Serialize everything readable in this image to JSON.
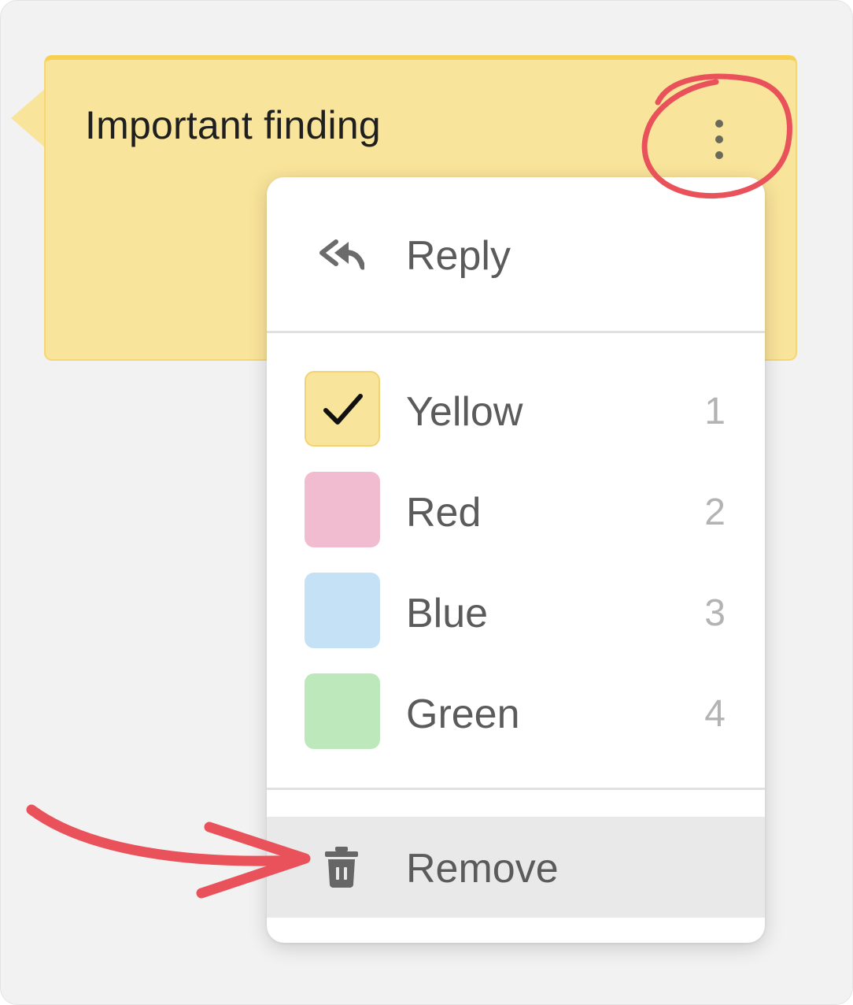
{
  "note": {
    "title": "Important finding",
    "color": "#f9e49b",
    "menu_icon": "more-vertical-icon"
  },
  "menu": {
    "reply": {
      "label": "Reply",
      "icon": "reply-all-icon"
    },
    "colors": [
      {
        "label": "Yellow",
        "shortcut": "1",
        "color": "#f9e49b",
        "selected": true
      },
      {
        "label": "Red",
        "shortcut": "2",
        "color": "#f1bcd0",
        "selected": false
      },
      {
        "label": "Blue",
        "shortcut": "3",
        "color": "#c5e1f6",
        "selected": false
      },
      {
        "label": "Green",
        "shortcut": "4",
        "color": "#bde8bb",
        "selected": false
      }
    ],
    "remove": {
      "label": "Remove",
      "icon": "trash-icon",
      "highlighted": true
    }
  },
  "annotations": {
    "color": "#e9525a",
    "marks": [
      "circle-around-menu-button",
      "arrow-to-remove"
    ]
  }
}
